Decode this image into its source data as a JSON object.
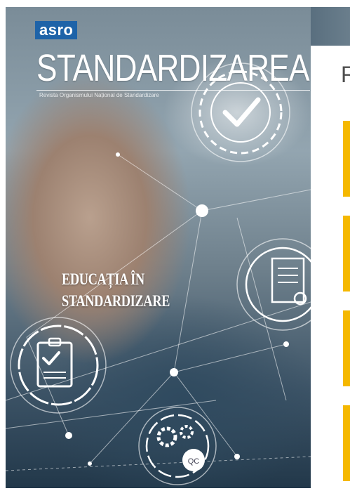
{
  "cover": {
    "logo": "asro",
    "masthead": "STANDARDIZAREA",
    "subtitle": "Revista Organismului Național de Standardizare",
    "headline_line1": "EDUCAȚIA ÎN",
    "headline_line2": "STANDARDIZARE",
    "badge_label": "QC"
  },
  "panel": {
    "heading": "R",
    "accent_color": "#f5b800",
    "bars": 4
  }
}
